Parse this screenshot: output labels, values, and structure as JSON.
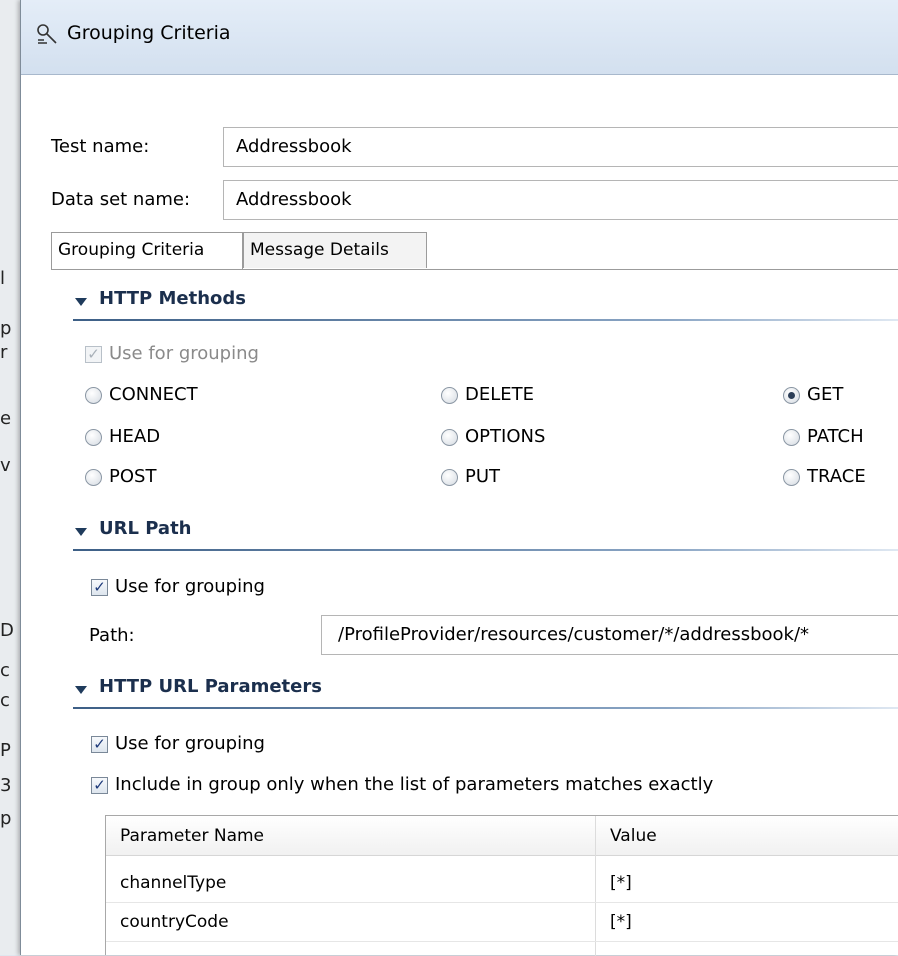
{
  "window": {
    "title": "Grouping Criteria"
  },
  "form": {
    "test_name_label": "Test name:",
    "test_name_value": "Addressbook",
    "data_set_label": "Data set name:",
    "data_set_value": "Addressbook"
  },
  "tabs": [
    {
      "label": "Grouping Criteria",
      "active": true
    },
    {
      "label": "Message Details",
      "active": false
    }
  ],
  "http_methods": {
    "title": "HTTP Methods",
    "use_for_grouping": {
      "label": "Use for grouping",
      "checked": true,
      "disabled": true
    },
    "options": [
      {
        "label": "CONNECT",
        "selected": false
      },
      {
        "label": "DELETE",
        "selected": false
      },
      {
        "label": "GET",
        "selected": true
      },
      {
        "label": "HEAD",
        "selected": false
      },
      {
        "label": "OPTIONS",
        "selected": false
      },
      {
        "label": "PATCH",
        "selected": false
      },
      {
        "label": "POST",
        "selected": false
      },
      {
        "label": "PUT",
        "selected": false
      },
      {
        "label": "TRACE",
        "selected": false
      }
    ]
  },
  "url_path": {
    "title": "URL Path",
    "use_for_grouping": {
      "label": "Use for grouping",
      "checked": true
    },
    "path_label": "Path:",
    "path_value": "/ProfileProvider/resources/customer/*/addressbook/*"
  },
  "url_params": {
    "title": "HTTP URL Parameters",
    "use_for_grouping": {
      "label": "Use for grouping",
      "checked": true
    },
    "exact_match": {
      "label": "Include in group only when the list of parameters matches exactly",
      "checked": true
    },
    "table": {
      "headers": [
        "Parameter Name",
        "Value"
      ],
      "rows": [
        [
          "channelType",
          "[*]"
        ],
        [
          "countryCode",
          "[*]"
        ]
      ]
    }
  },
  "glyphs": {
    "check": "✓"
  },
  "colors": {
    "section_title": "#1b2f4d",
    "titlebar": "#dce7f4"
  }
}
